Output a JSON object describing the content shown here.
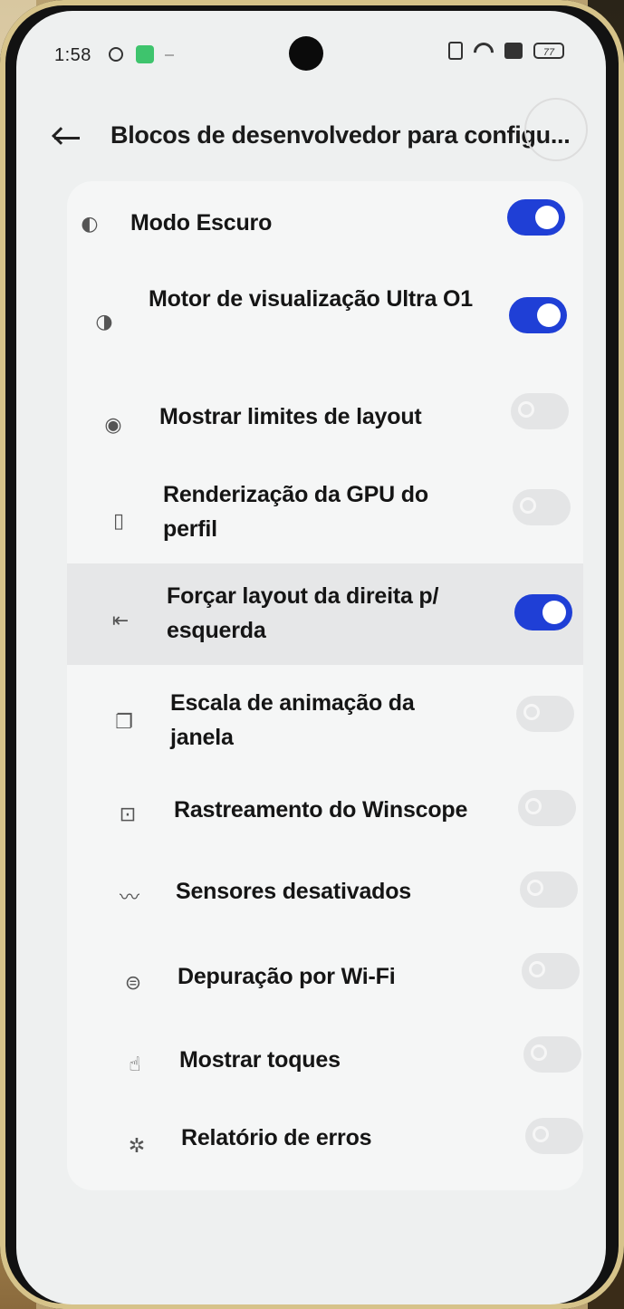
{
  "status_bar": {
    "time": "1:58",
    "battery": "77"
  },
  "header": {
    "title": "Blocos de desenvolvedor para configu..."
  },
  "tiles": [
    {
      "label": "Modo Escuro",
      "icon": "dark-mode-icon",
      "enabled": true
    },
    {
      "label": "Motor de visualização Ultra O1",
      "icon": "display-engine-icon",
      "enabled": true
    },
    {
      "label": "Mostrar limites de layout",
      "icon": "layout-bounds-icon",
      "enabled": false
    },
    {
      "label": "Renderização da GPU do perfil",
      "icon": "gpu-profile-icon",
      "enabled": false
    },
    {
      "label": "Forçar layout da direita p/ esquerda",
      "icon": "rtl-layout-icon",
      "enabled": true
    },
    {
      "label": "Escala de animação da janela",
      "icon": "window-animation-icon",
      "enabled": false
    },
    {
      "label": "Rastreamento do Winscope",
      "icon": "winscope-icon",
      "enabled": false
    },
    {
      "label": "Sensores desativados",
      "icon": "sensors-off-icon",
      "enabled": false
    },
    {
      "label": "Depuração por Wi-Fi",
      "icon": "wifi-debug-icon",
      "enabled": false
    },
    {
      "label": "Mostrar toques",
      "icon": "touch-icon",
      "enabled": false
    },
    {
      "label": "Relatório de erros",
      "icon": "bug-report-icon",
      "enabled": false
    }
  ],
  "colors": {
    "toggle_on": "#1f3fd6",
    "toggle_off": "#e4e5e6",
    "background": "#eef0f0"
  }
}
